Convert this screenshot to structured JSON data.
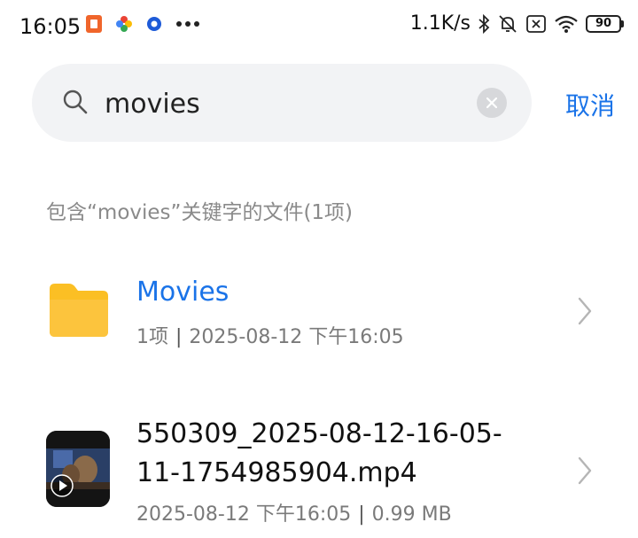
{
  "status_bar": {
    "time": "16:05",
    "net_speed": "1.1K/s",
    "battery": "90"
  },
  "search": {
    "query": "movies",
    "cancel_label": "取消"
  },
  "results_label": "包含“movies”关键字的文件(1项)",
  "results": [
    {
      "type": "folder",
      "name": "Movies",
      "count": "1项",
      "date": "2025-08-12 下午16:05"
    },
    {
      "type": "video",
      "name": "550309_2025-08-12-16-05-11-1754985904.mp4",
      "date": "2025-08-12 下午16:05",
      "size": "0.99 MB"
    }
  ],
  "colors": {
    "accent": "#1a73e8",
    "folder": "#fbbf24",
    "search_bg": "#f2f3f5"
  }
}
